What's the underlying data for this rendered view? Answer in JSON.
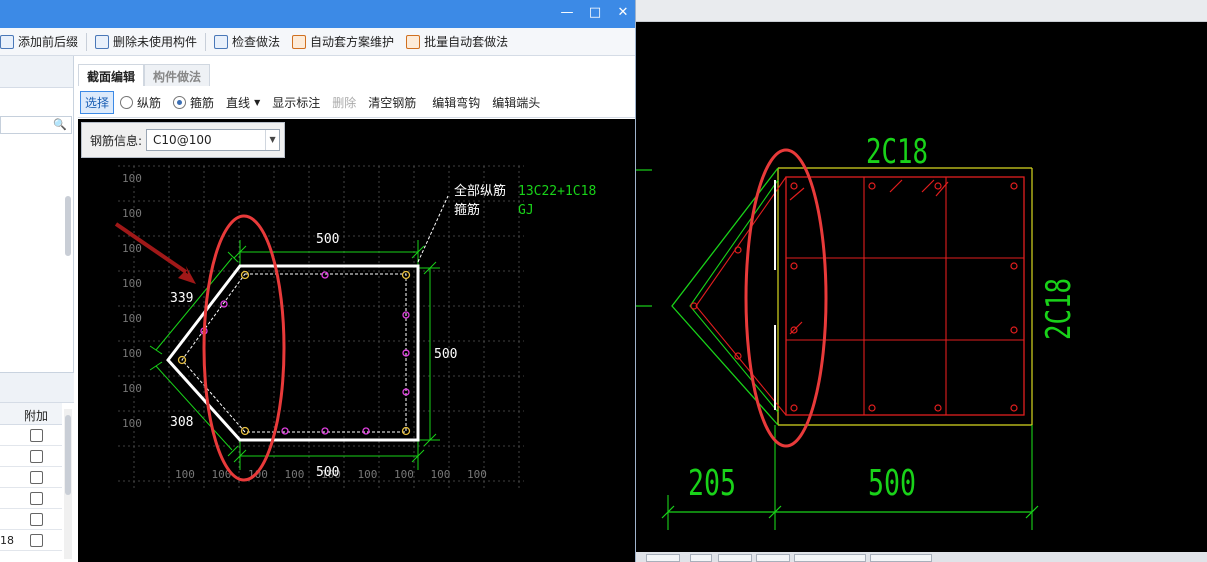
{
  "window": {
    "minimize": "—",
    "maximize": "□",
    "close": "✕"
  },
  "toolbar": {
    "add_prefix_suffix": "添加前后缀",
    "delete_unused": "删除未使用构件",
    "check_method": "检查做法",
    "auto_scheme_maintain": "自动套方案维护",
    "batch_auto_apply": "批量自动套做法"
  },
  "left_panel": {
    "search_icon": "🔍",
    "column_header": "附加",
    "row_number": "18"
  },
  "tabs": {
    "section_edit": "截面编辑",
    "component_method": "构件做法"
  },
  "editbar": {
    "select": "选择",
    "longitudinal": "纵筋",
    "stirrup": "箍筋",
    "line_mode": "直线",
    "show_annotation": "显示标注",
    "delete": "删除",
    "clear_rebar": "清空钢筋",
    "edit_hook": "编辑弯钩",
    "edit_end": "编辑端头"
  },
  "rebar_info": {
    "label": "钢筋信息:",
    "value": "C10@100"
  },
  "section_drawing": {
    "grid_label": "100",
    "dim_top": "500",
    "dim_right": "500",
    "dim_bottom": "500",
    "dim_upper_slant": "339",
    "dim_lower_slant": "308",
    "all_long_rebar_label": "全部纵筋",
    "all_long_rebar_value": "13C22+1C18",
    "stirrup_label": "箍筋",
    "stirrup_value": "GJ"
  },
  "cad_drawing": {
    "top_rebar": "2C18",
    "right_rebar": "2C18",
    "dim_left": "205",
    "dim_main": "500"
  },
  "colors": {
    "title_bar": "#3c8ae6",
    "cad_green": "#19d219",
    "cad_red": "#e01e1e",
    "cad_yellow": "#d8d820",
    "highlight_ellipse": "#e83a3a",
    "rebar_magenta": "#e040e0",
    "rebar_yellow": "#e8c040"
  }
}
